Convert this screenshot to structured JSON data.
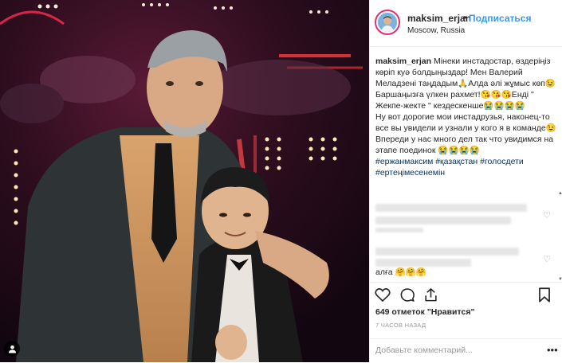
{
  "post": {
    "username": "maksim_erjan",
    "separator": "•",
    "follow_label": "Подписаться",
    "location": "Moscow, Russia",
    "more_icon": "ellipsis-icon"
  },
  "caption": {
    "username": "maksim_erjan",
    "line1": "Мінеки инстадостар, өздеріңіз көріп куә болдыңыздар! Мен Валерий Меладзені таңдадым🙏Алда әлі жұмыс көп😉Баршаңызға үлкен рахмет!😘😘😘Енді \" Жекпе-жекте \" кездескенше😭😭😭😭",
    "line2": "Ну вот дорогие мои инстадрузья, наконец-то все вы увидели и узнали у кого я в команде😉Впереди у нас много дел так что увидимся на этапе поединок 😭😭😭😭",
    "tags": "#ержанмаксим #қазақстан #голосдети #ертеңімесенемін"
  },
  "blurred_comments": [
    {
      "text_hidden": true
    },
    {
      "text_hidden": true
    }
  ],
  "last_comment": "алға 🤗🤗🤗",
  "actions": {
    "like_icon": "heart-icon",
    "comment_icon": "comment-icon",
    "share_icon": "share-icon",
    "save_icon": "bookmark-icon"
  },
  "likes_text": "649 отметок \"Нравится\"",
  "time_text": "7 ЧАСОВ НАЗАД",
  "add_comment_placeholder": "Добавьте комментарий...",
  "add_comment_more": "•••",
  "colors": {
    "follow": "#3897f0",
    "hashtag": "#003569",
    "border": "#efefef",
    "muted": "#999999"
  }
}
